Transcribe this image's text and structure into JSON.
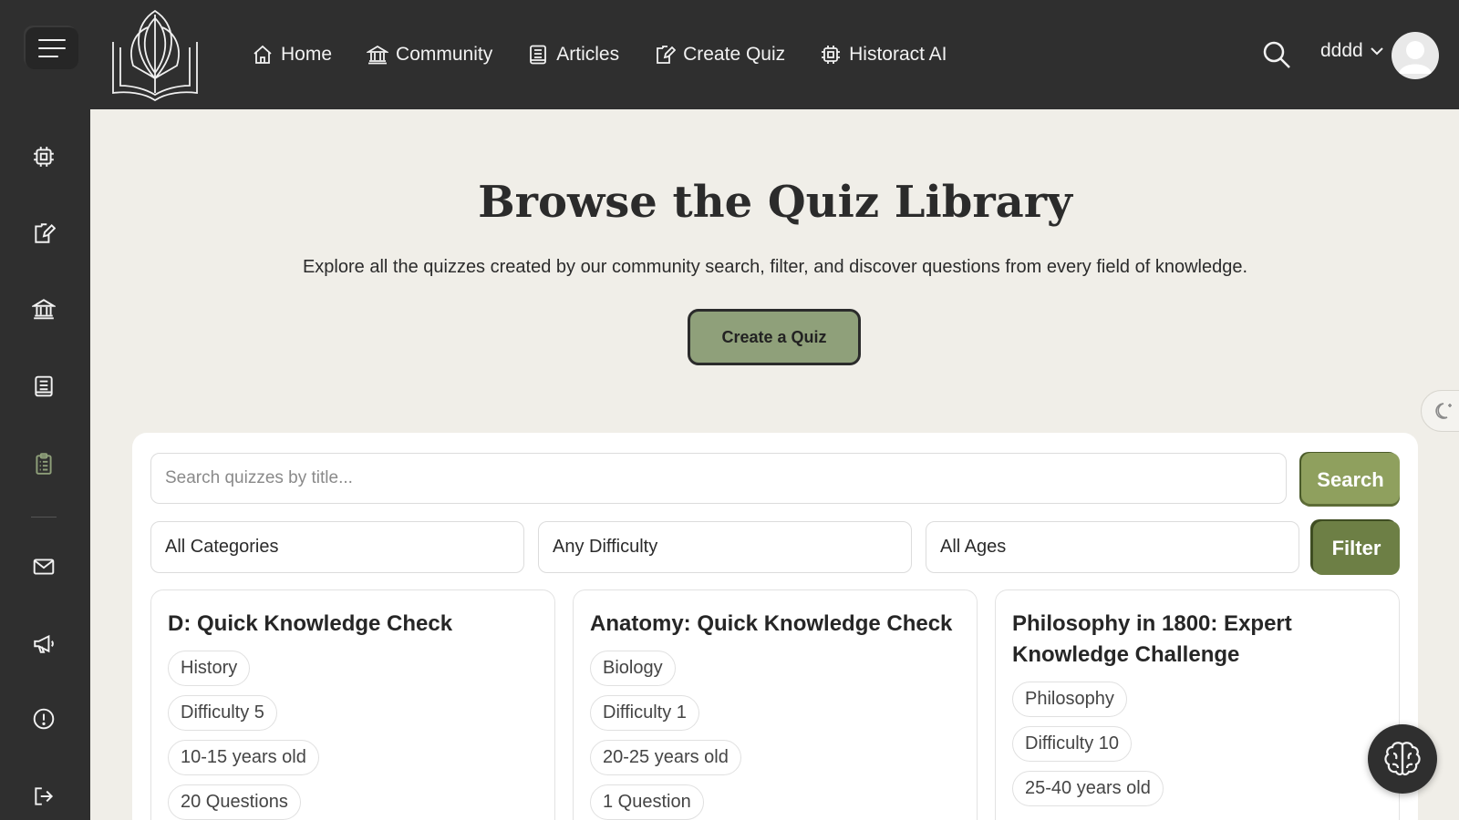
{
  "nav": {
    "items": [
      {
        "label": "Home",
        "icon": "home-icon"
      },
      {
        "label": "Community",
        "icon": "institution-icon"
      },
      {
        "label": "Articles",
        "icon": "article-icon"
      },
      {
        "label": "Create Quiz",
        "icon": "edit-document-icon"
      },
      {
        "label": "Historact AI",
        "icon": "chip-icon"
      }
    ]
  },
  "user": {
    "name": "dddd"
  },
  "sidebar": {
    "icons": [
      "chip-icon",
      "edit-document-icon",
      "institution-icon",
      "article-icon",
      "clipboard-icon",
      "mail-icon",
      "megaphone-icon",
      "alert-icon",
      "logout-icon"
    ],
    "active_color": "#8fa07a"
  },
  "hero": {
    "title": "Browse the Quiz Library",
    "subtitle": "Explore all the quizzes created by our community search, filter, and discover questions from every field of knowledge.",
    "create_button": "Create a Quiz"
  },
  "search": {
    "placeholder": "Search quizzes by title...",
    "value": "",
    "button": "Search"
  },
  "filters": {
    "category": "All Categories",
    "difficulty": "Any Difficulty",
    "age": "All Ages",
    "button": "Filter"
  },
  "quizzes": [
    {
      "title": "D: Quick Knowledge Check",
      "category": "History",
      "difficulty": "Difficulty 5",
      "age": "10-15 years old",
      "questions": "20 Questions"
    },
    {
      "title": "Anatomy: Quick Knowledge Check",
      "category": "Biology",
      "difficulty": "Difficulty 1",
      "age": "20-25 years old",
      "questions": "1 Question"
    },
    {
      "title": "Philosophy in 1800: Expert Knowledge Challenge",
      "category": "Philosophy",
      "difficulty": "Difficulty 10",
      "age": "25-40 years old",
      "questions": ""
    }
  ],
  "colors": {
    "topbar": "#2f2f2f",
    "background": "#f0eee8",
    "accent": "#8fa07a",
    "filter": "#6d7f45"
  }
}
